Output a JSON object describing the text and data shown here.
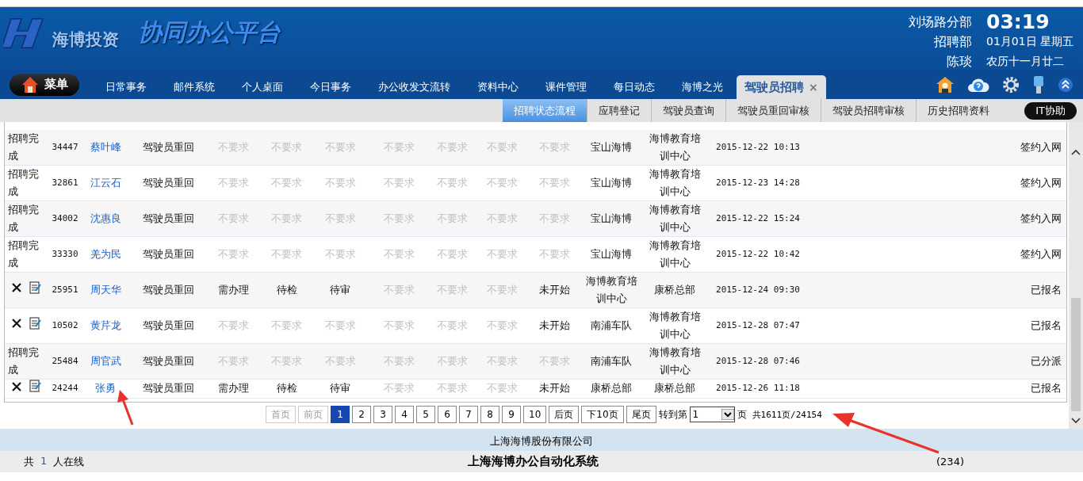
{
  "header": {
    "logo_text": "海博投资",
    "title": "协同办公平台",
    "branch": "刘场路分部",
    "department": "招聘部",
    "user": "陈琰",
    "time": "03:19",
    "date": "01月01日 星期五",
    "lunar": "农历十一月廿二"
  },
  "menu_button": "菜单",
  "nav_tabs": [
    {
      "label": "日常事务",
      "selected": false
    },
    {
      "label": "邮件系统",
      "selected": false
    },
    {
      "label": "个人桌面",
      "selected": false
    },
    {
      "label": "今日事务",
      "selected": false
    },
    {
      "label": "办公收发文流转",
      "selected": false
    },
    {
      "label": "资料中心",
      "selected": false
    },
    {
      "label": "课件管理",
      "selected": false
    },
    {
      "label": "每日动态",
      "selected": false
    },
    {
      "label": "海博之光",
      "selected": false
    },
    {
      "label": "驾驶员招聘",
      "selected": true,
      "close": "×"
    }
  ],
  "sub_tabs": [
    {
      "label": "招聘状态流程",
      "selected": true
    },
    {
      "label": "应聘登记",
      "selected": false
    },
    {
      "label": "驾驶员查询",
      "selected": false
    },
    {
      "label": "驾驶员重回审核",
      "selected": false
    },
    {
      "label": "驾驶员招聘审核",
      "selected": false
    },
    {
      "label": "历史招聘资料",
      "selected": false
    }
  ],
  "help_button": "IT协助",
  "table": {
    "rows": [
      {
        "kind": "done",
        "status": "招聘完成",
        "id": "34447",
        "name": "蔡叶峰",
        "cells": [
          {
            "text": "驾驶员重回",
            "muted": false
          },
          {
            "text": "不要求",
            "muted": true
          },
          {
            "text": "不要求",
            "muted": true
          },
          {
            "text": "不要求",
            "muted": true
          },
          {
            "text": "不要求",
            "muted": true
          },
          {
            "text": "不要求",
            "muted": true
          },
          {
            "text": "不要求",
            "muted": true
          },
          {
            "text": "不要求",
            "muted": true
          },
          {
            "text": "宝山海博",
            "muted": false
          },
          {
            "text": "海博教育培训中心",
            "muted": false
          }
        ],
        "date": "2015-12-22 10:13",
        "result": "签约入网"
      },
      {
        "kind": "done",
        "status": "招聘完成",
        "id": "32861",
        "name": "江云石",
        "cells": [
          {
            "text": "驾驶员重回",
            "muted": false
          },
          {
            "text": "不要求",
            "muted": true
          },
          {
            "text": "不要求",
            "muted": true
          },
          {
            "text": "不要求",
            "muted": true
          },
          {
            "text": "不要求",
            "muted": true
          },
          {
            "text": "不要求",
            "muted": true
          },
          {
            "text": "不要求",
            "muted": true
          },
          {
            "text": "不要求",
            "muted": true
          },
          {
            "text": "宝山海博",
            "muted": false
          },
          {
            "text": "海博教育培训中心",
            "muted": false
          }
        ],
        "date": "2015-12-23 14:28",
        "result": "签约入网"
      },
      {
        "kind": "done",
        "status": "招聘完成",
        "id": "34002",
        "name": "沈惠良",
        "cells": [
          {
            "text": "驾驶员重回",
            "muted": false
          },
          {
            "text": "不要求",
            "muted": true
          },
          {
            "text": "不要求",
            "muted": true
          },
          {
            "text": "不要求",
            "muted": true
          },
          {
            "text": "不要求",
            "muted": true
          },
          {
            "text": "不要求",
            "muted": true
          },
          {
            "text": "不要求",
            "muted": true
          },
          {
            "text": "不要求",
            "muted": true
          },
          {
            "text": "宝山海博",
            "muted": false
          },
          {
            "text": "海博教育培训中心",
            "muted": false
          }
        ],
        "date": "2015-12-22 15:24",
        "result": "签约入网"
      },
      {
        "kind": "done",
        "status": "招聘完成",
        "id": "33330",
        "name": "羌为民",
        "cells": [
          {
            "text": "驾驶员重回",
            "muted": false
          },
          {
            "text": "不要求",
            "muted": true
          },
          {
            "text": "不要求",
            "muted": true
          },
          {
            "text": "不要求",
            "muted": true
          },
          {
            "text": "不要求",
            "muted": true
          },
          {
            "text": "不要求",
            "muted": true
          },
          {
            "text": "不要求",
            "muted": true
          },
          {
            "text": "不要求",
            "muted": true
          },
          {
            "text": "宝山海博",
            "muted": false
          },
          {
            "text": "海博教育培训中心",
            "muted": false
          }
        ],
        "date": "2015-12-22 10:42",
        "result": "签约入网"
      },
      {
        "kind": "pending",
        "id": "25951",
        "name": "周天华",
        "cells": [
          {
            "text": "驾驶员重回",
            "muted": false
          },
          {
            "text": "需办理",
            "muted": false
          },
          {
            "text": "待检",
            "muted": false
          },
          {
            "text": "待审",
            "muted": false
          },
          {
            "text": "不要求",
            "muted": true
          },
          {
            "text": "不要求",
            "muted": true
          },
          {
            "text": "不要求",
            "muted": true
          },
          {
            "text": "未开始",
            "muted": false
          },
          {
            "text": "海博教育培训中心",
            "muted": false
          },
          {
            "text": "康桥总部",
            "muted": false
          }
        ],
        "date": "2015-12-24 09:30",
        "result": "已报名"
      },
      {
        "kind": "pending",
        "id": "10502",
        "name": "黄芹龙",
        "cells": [
          {
            "text": "驾驶员重回",
            "muted": false
          },
          {
            "text": "不要求",
            "muted": true
          },
          {
            "text": "不要求",
            "muted": true
          },
          {
            "text": "不要求",
            "muted": true
          },
          {
            "text": "不要求",
            "muted": true
          },
          {
            "text": "不要求",
            "muted": true
          },
          {
            "text": "不要求",
            "muted": true
          },
          {
            "text": "未开始",
            "muted": false
          },
          {
            "text": "南浦车队",
            "muted": false
          },
          {
            "text": "海博教育培训中心",
            "muted": false
          }
        ],
        "date": "2015-12-28 07:47",
        "result": "已报名"
      },
      {
        "kind": "done",
        "status": "招聘完成",
        "id": "25484",
        "name": "周官武",
        "cells": [
          {
            "text": "驾驶员重回",
            "muted": false
          },
          {
            "text": "不要求",
            "muted": true
          },
          {
            "text": "不要求",
            "muted": true
          },
          {
            "text": "不要求",
            "muted": true
          },
          {
            "text": "不要求",
            "muted": true
          },
          {
            "text": "不要求",
            "muted": true
          },
          {
            "text": "不要求",
            "muted": true
          },
          {
            "text": "不要求",
            "muted": true
          },
          {
            "text": "南浦车队",
            "muted": false
          },
          {
            "text": "海博教育培训中心",
            "muted": false
          }
        ],
        "date": "2015-12-28 07:46",
        "result": "已分派"
      },
      {
        "kind": "pending",
        "id": "24244",
        "name": "张勇",
        "cells": [
          {
            "text": "驾驶员重回",
            "muted": false
          },
          {
            "text": "需办理",
            "muted": false
          },
          {
            "text": "待检",
            "muted": false
          },
          {
            "text": "待审",
            "muted": false
          },
          {
            "text": "不要求",
            "muted": true
          },
          {
            "text": "不要求",
            "muted": true
          },
          {
            "text": "不要求",
            "muted": true
          },
          {
            "text": "未开始",
            "muted": false
          },
          {
            "text": "康桥总部",
            "muted": false
          },
          {
            "text": "康桥总部",
            "muted": false
          }
        ],
        "date": "2015-12-26 11:18",
        "result": "已报名"
      }
    ]
  },
  "pagination": {
    "buttons": [
      {
        "label": "首页",
        "disabled": true,
        "selected": false
      },
      {
        "label": "前页",
        "disabled": true,
        "selected": false
      },
      {
        "label": "1",
        "disabled": false,
        "selected": true
      },
      {
        "label": "2",
        "disabled": false,
        "selected": false
      },
      {
        "label": "3",
        "disabled": false,
        "selected": false
      },
      {
        "label": "4",
        "disabled": false,
        "selected": false
      },
      {
        "label": "5",
        "disabled": false,
        "selected": false
      },
      {
        "label": "6",
        "disabled": false,
        "selected": false
      },
      {
        "label": "7",
        "disabled": false,
        "selected": false
      },
      {
        "label": "8",
        "disabled": false,
        "selected": false
      },
      {
        "label": "9",
        "disabled": false,
        "selected": false
      },
      {
        "label": "10",
        "disabled": false,
        "selected": false
      },
      {
        "label": "后页",
        "disabled": false,
        "selected": false
      },
      {
        "label": "下10页",
        "disabled": false,
        "selected": false
      },
      {
        "label": "尾页",
        "disabled": false,
        "selected": false
      }
    ],
    "goto_label": "转到第",
    "goto_value": "1",
    "page_unit": "页",
    "total": "共1611页/24154"
  },
  "footer": {
    "company": "上海海博股份有限公司",
    "online_prefix": "共",
    "online_count": "1",
    "online_suffix": "人在线",
    "system_name": "上海海博办公自动化系统",
    "message_count": "(234)"
  }
}
